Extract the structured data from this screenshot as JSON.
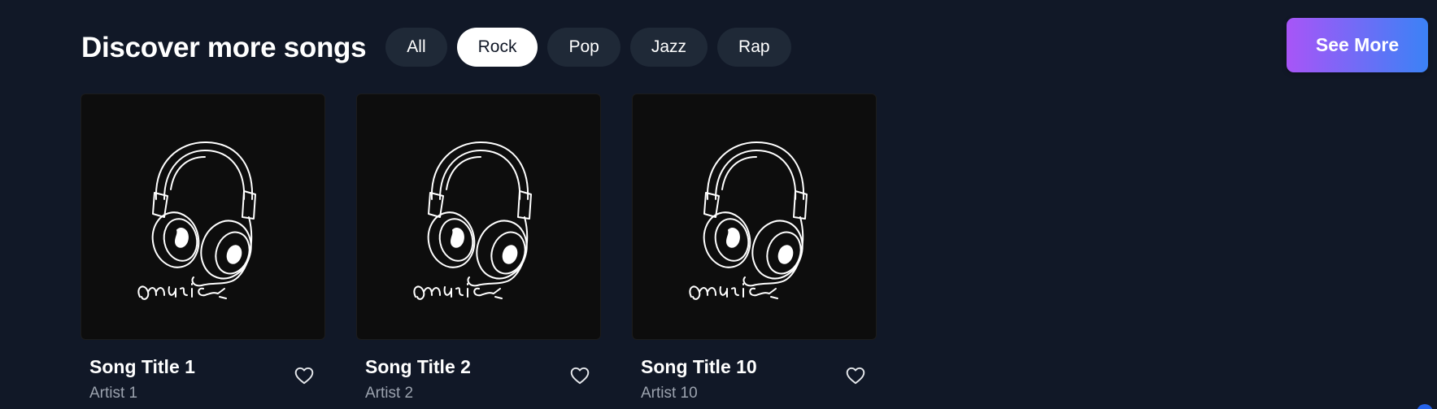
{
  "header": {
    "title": "Discover more songs",
    "genres": [
      "All",
      "Rock",
      "Pop",
      "Jazz",
      "Rap"
    ],
    "active_genre": "Rock",
    "see_more_label": "See More"
  },
  "songs": [
    {
      "title": "Song Title 1",
      "artist": "Artist 1",
      "cover_icon": "headphones-music-icon",
      "cover_text": "music"
    },
    {
      "title": "Song Title 2",
      "artist": "Artist 2",
      "cover_icon": "headphones-music-icon",
      "cover_text": "music"
    },
    {
      "title": "Song Title 10",
      "artist": "Artist 10",
      "cover_icon": "headphones-music-icon",
      "cover_text": "music"
    }
  ],
  "colors": {
    "background": "#111827",
    "chip_bg": "#1f2937",
    "chip_active_bg": "#ffffff",
    "button_gradient_start": "#a855f7",
    "button_gradient_end": "#3b82f6",
    "artist_text": "#9ca3af"
  }
}
